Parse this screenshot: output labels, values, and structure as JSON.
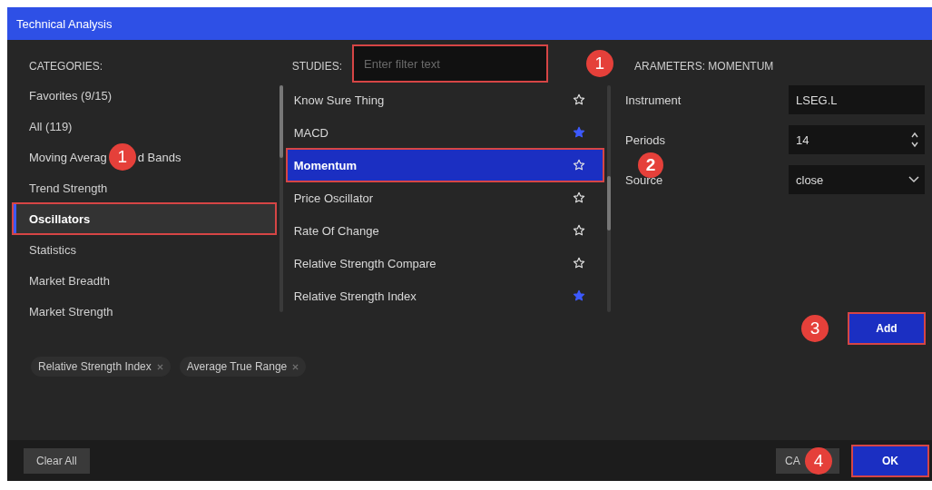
{
  "window": {
    "title": "Technical Analysis"
  },
  "categories": {
    "header": "CATEGORIES:",
    "items": [
      {
        "label": "Favorites (9/15)",
        "selected": false,
        "annotated": false
      },
      {
        "label": "All (119)",
        "selected": false,
        "annotated": false
      },
      {
        "label": "Moving Averag",
        "label_end": "d Bands",
        "callout": "1",
        "selected": false,
        "annotated": false
      },
      {
        "label": "Trend Strength",
        "selected": false,
        "annotated": false
      },
      {
        "label": "Oscillators",
        "selected": true,
        "annotated": true
      },
      {
        "label": "Statistics",
        "selected": false,
        "annotated": false
      },
      {
        "label": "Market Breadth",
        "selected": false,
        "annotated": false
      },
      {
        "label": "Market Strength",
        "selected": false,
        "annotated": false
      }
    ]
  },
  "studies": {
    "header": "STUDIES:",
    "filter": {
      "placeholder": "Enter filter text",
      "annotated": true,
      "callout": "1"
    },
    "items": [
      {
        "label": "Know Sure Thing",
        "favorite": false,
        "selected": false,
        "annotated": false
      },
      {
        "label": "MACD",
        "favorite": true,
        "selected": false,
        "annotated": false
      },
      {
        "label": "Momentum",
        "favorite": false,
        "selected": true,
        "annotated": true,
        "callout": "2"
      },
      {
        "label": "Price Oscillator",
        "favorite": false,
        "selected": false,
        "annotated": false
      },
      {
        "label": "Rate Of Change",
        "favorite": false,
        "selected": false,
        "annotated": false
      },
      {
        "label": "Relative Strength Compare",
        "favorite": false,
        "selected": false,
        "annotated": false
      },
      {
        "label": "Relative Strength Index",
        "favorite": true,
        "selected": false,
        "annotated": false
      }
    ]
  },
  "parameters": {
    "header": "ARAMETERS: MOMENTUM",
    "fields": [
      {
        "label": "Instrument",
        "value": "LSEG.L",
        "kind": "text"
      },
      {
        "label": "Periods",
        "value": "14",
        "kind": "spinner"
      },
      {
        "label": "Source",
        "value": "close",
        "kind": "select"
      }
    ],
    "add_button": {
      "label": "Add",
      "annotated": true,
      "callout": "3"
    }
  },
  "selected_studies": [
    "Relative Strength Index",
    "Average True Range"
  ],
  "footer": {
    "clear_button": "Clear All",
    "cancel_button": {
      "label": "CA",
      "callout": "4"
    },
    "ok_button": {
      "label": "OK",
      "annotated": true
    }
  }
}
